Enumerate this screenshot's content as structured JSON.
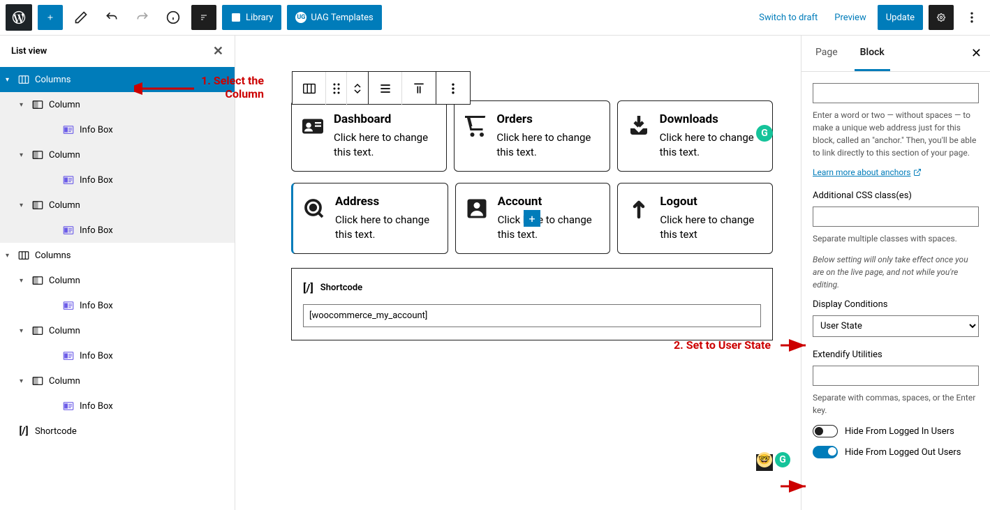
{
  "topbar": {
    "library_label": "Library",
    "uag_label": "UAG Templates",
    "switch_draft": "Switch to draft",
    "preview": "Preview",
    "update": "Update"
  },
  "listview": {
    "title": "List view",
    "items": [
      {
        "label": "Columns",
        "depth": 0,
        "selected": true,
        "icon": "columns",
        "chevron": true
      },
      {
        "label": "Column",
        "depth": 1,
        "grey": true,
        "icon": "column",
        "chevron": true
      },
      {
        "label": "Info Box",
        "depth": 2,
        "grey": true,
        "icon": "infobox"
      },
      {
        "label": "Column",
        "depth": 1,
        "grey": true,
        "icon": "column",
        "chevron": true
      },
      {
        "label": "Info Box",
        "depth": 2,
        "grey": true,
        "icon": "infobox"
      },
      {
        "label": "Column",
        "depth": 1,
        "grey": true,
        "icon": "column",
        "chevron": true
      },
      {
        "label": "Info Box",
        "depth": 2,
        "grey": true,
        "icon": "infobox"
      },
      {
        "label": "Columns",
        "depth": 0,
        "icon": "columns",
        "chevron": true
      },
      {
        "label": "Column",
        "depth": 1,
        "icon": "column",
        "chevron": true
      },
      {
        "label": "Info Box",
        "depth": 2,
        "icon": "infobox"
      },
      {
        "label": "Column",
        "depth": 1,
        "icon": "column",
        "chevron": true
      },
      {
        "label": "Info Box",
        "depth": 2,
        "icon": "infobox"
      },
      {
        "label": "Column",
        "depth": 1,
        "icon": "column",
        "chevron": true
      },
      {
        "label": "Info Box",
        "depth": 2,
        "icon": "infobox"
      },
      {
        "label": "Shortcode",
        "depth": 0,
        "icon": "shortcode"
      }
    ]
  },
  "cards_row1": [
    {
      "title": "Dashboard",
      "text": "Click here to change this text.",
      "icon": "id"
    },
    {
      "title": "Orders",
      "text": "Click here to change this text.",
      "icon": "cart"
    },
    {
      "title": "Downloads",
      "text": "Click here to change this text.",
      "icon": "download"
    }
  ],
  "cards_row2": [
    {
      "title": "Address",
      "text": "Click here to change this text.",
      "icon": "location"
    },
    {
      "title": "Account",
      "text": "Click here to change this text.",
      "icon": "person"
    },
    {
      "title": "Logout",
      "text": "Click here to change this text",
      "icon": "up"
    }
  ],
  "shortcode": {
    "label": "Shortcode",
    "value": "[woocommerce_my_account]"
  },
  "sidebar_right": {
    "tab_page": "Page",
    "tab_block": "Block",
    "anchor_help": "Enter a word or two — without spaces — to make a unique web address just for this block, called an \"anchor.\" Then, you'll be able to link directly to this section of your page.",
    "anchor_link": "Learn more about anchors",
    "css_label": "Additional CSS class(es)",
    "css_help": "Separate multiple classes with spaces.",
    "display_note": "Below setting will only take effect once you are on the live page, and not while you're editing.",
    "display_label": "Display Conditions",
    "display_value": "User State",
    "extendify_label": "Extendify Utilities",
    "extendify_help": "Separate with commas, spaces, or the Enter key.",
    "toggle1": "Hide From Logged In Users",
    "toggle2": "Hide From Logged Out Users"
  },
  "annotations": {
    "a1": "1. Select the Column",
    "a2": "2. Set to User State"
  }
}
